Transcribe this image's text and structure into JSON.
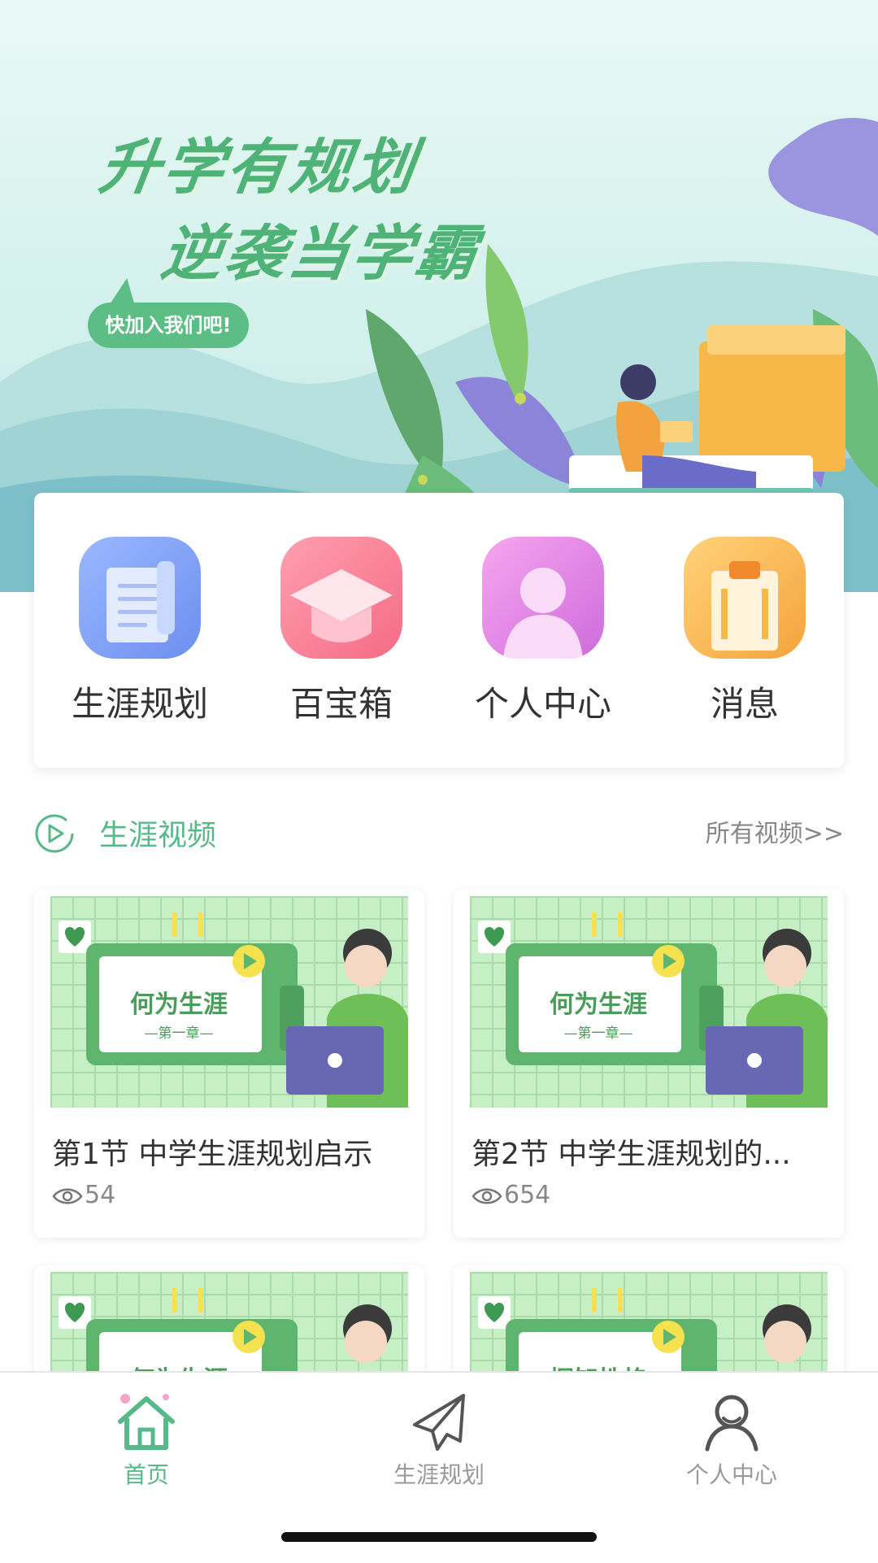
{
  "banner": {
    "title": "升学有规划",
    "subtitle": "逆袭当学霸",
    "join_text": "快加入我们吧!"
  },
  "menu": [
    {
      "label": "生涯规划",
      "icon": "scroll-icon"
    },
    {
      "label": "百宝箱",
      "icon": "graduation-cap-icon"
    },
    {
      "label": "个人中心",
      "icon": "person-icon"
    },
    {
      "label": "消息",
      "icon": "clipboard-icon"
    }
  ],
  "section": {
    "title": "生涯视频",
    "more": "所有视频>>",
    "icon": "play-circle-icon"
  },
  "videos": [
    {
      "title": "第1节 中学生涯规划启示",
      "views": "54",
      "thumb_title": "何为生涯",
      "thumb_sub": "—第一章—"
    },
    {
      "title": "第2节 中学生涯规划的...",
      "views": "654",
      "thumb_title": "何为生涯",
      "thumb_sub": "—第一章—"
    },
    {
      "title": "",
      "views": "",
      "thumb_title": "何为生涯",
      "thumb_sub": ""
    },
    {
      "title": "",
      "views": "",
      "thumb_title": "探知性格",
      "thumb_sub": ""
    }
  ],
  "tabs": [
    {
      "label": "首页",
      "icon": "home-icon",
      "active": true
    },
    {
      "label": "生涯规划",
      "icon": "paper-plane-icon",
      "active": false
    },
    {
      "label": "个人中心",
      "icon": "user-icon",
      "active": false
    }
  ],
  "colors": {
    "accent": "#57b989",
    "banner_text": "#4fb277",
    "inactive": "#999999"
  }
}
